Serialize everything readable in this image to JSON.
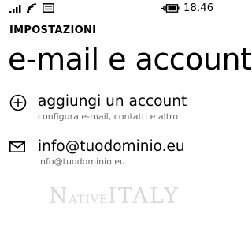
{
  "status_bar": {
    "time": "18.46",
    "icons": [
      "signal-bars-icon",
      "wifi-icon",
      "message-icon",
      "battery-charging-icon"
    ]
  },
  "header": {
    "section": "IMPOSTAZIONI",
    "title": "e-mail e account"
  },
  "items": [
    {
      "icon": "add-circle-icon",
      "title": "aggiungi un account",
      "subtitle": "configura e-mail, contatti e altro"
    },
    {
      "icon": "mail-icon",
      "title": "info@tuodominio.eu",
      "subtitle": "info@tuodominio.eu"
    }
  ],
  "watermark": {
    "small_n": "N",
    "small_rest": "ATIVE",
    "big": "ITALY"
  }
}
